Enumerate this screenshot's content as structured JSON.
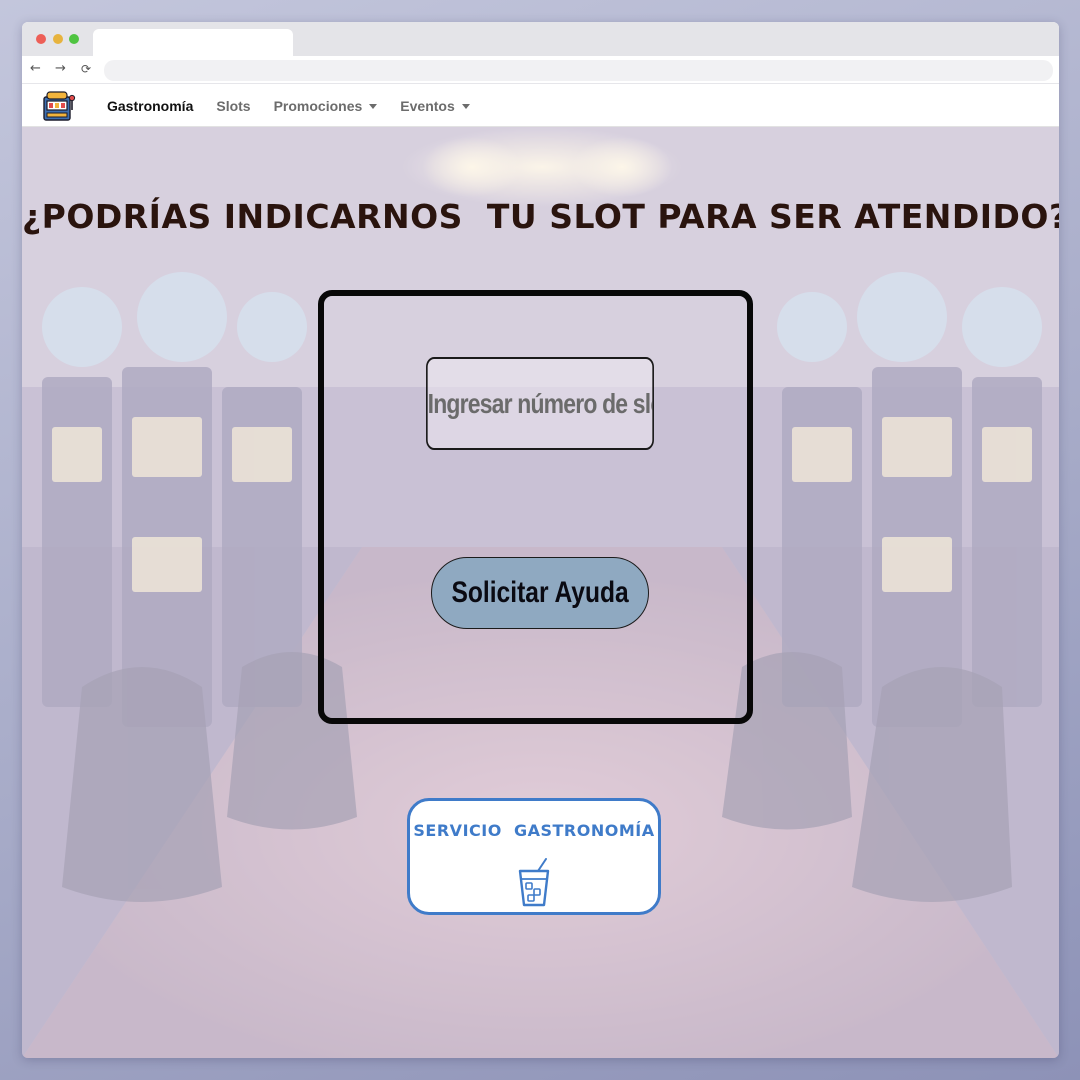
{
  "browser": {
    "back_glyph": "←",
    "forward_glyph": "→",
    "reload_glyph": "⟳"
  },
  "navbar": {
    "logo_icon": "slot-machine-icon",
    "links": [
      {
        "label": "Gastronomía",
        "active": true
      },
      {
        "label": "Slots"
      },
      {
        "label": "Promociones",
        "dropdown": true
      },
      {
        "label": "Eventos",
        "dropdown": true
      }
    ]
  },
  "main": {
    "heading": "¿PODRÍAS INDICARNOS  TU SLOT PARA SER ATENDIDO?",
    "slot_input_placeholder": "Ingresar número de slot",
    "help_button_label": "Solicitar Ayuda",
    "food_service_label": "SERVICIO  GASTRONOMÍA",
    "food_service_icon": "drink-glass-icon",
    "background_image": "casino slot machine hall"
  },
  "colors": {
    "heading": "#2a140e",
    "help_button_bg": "#8fa9c1",
    "food_service_accent": "#3f7bc9"
  }
}
